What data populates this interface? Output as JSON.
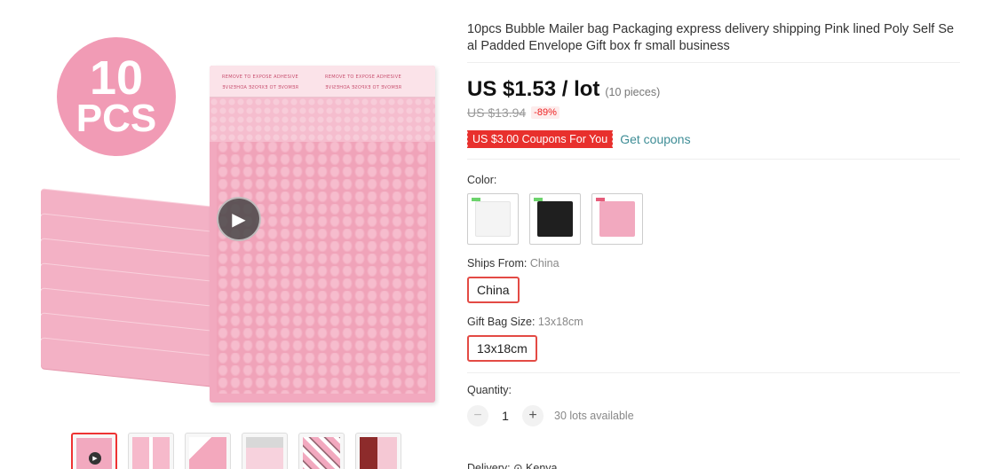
{
  "gallery": {
    "badge_number": "10",
    "badge_unit": "PCS",
    "strip_text": "REMOVE TO EXPOSE ADHESIVE",
    "colors": {
      "bag": "#f2a9bf",
      "badge": "#f19bb5",
      "active_border": "#ee3333"
    }
  },
  "product": {
    "title": "10pcs Bubble Mailer bag Packaging express delivery shipping Pink lined Poly Self Seal Padded Envelope Gift box fr small business",
    "price": "US $1.53 / lot",
    "pieces": "(10 pieces)",
    "original_price": "US $13.94",
    "discount": "-89%",
    "coupon": "US $3.00 Coupons For You",
    "get_coupons": "Get coupons"
  },
  "options": {
    "color_label": "Color:",
    "colors": [
      {
        "name": "white",
        "color": "#f4f4f4"
      },
      {
        "name": "black",
        "color": "#1f1f1f"
      },
      {
        "name": "pink",
        "color": "#f2a9bf"
      }
    ],
    "ships_from_label": "Ships From:",
    "ships_from_value": "China",
    "ships_from_selected": "China",
    "gift_bag_label": "Gift Bag Size:",
    "gift_bag_value": "13x18cm",
    "gift_bag_selected": "13x18cm",
    "quantity_label": "Quantity:",
    "quantity_minus": "−",
    "quantity_value": "1",
    "quantity_plus": "+",
    "lots_available": "30 lots available"
  },
  "delivery": {
    "label": "Delivery: ⊙ Kenya"
  }
}
